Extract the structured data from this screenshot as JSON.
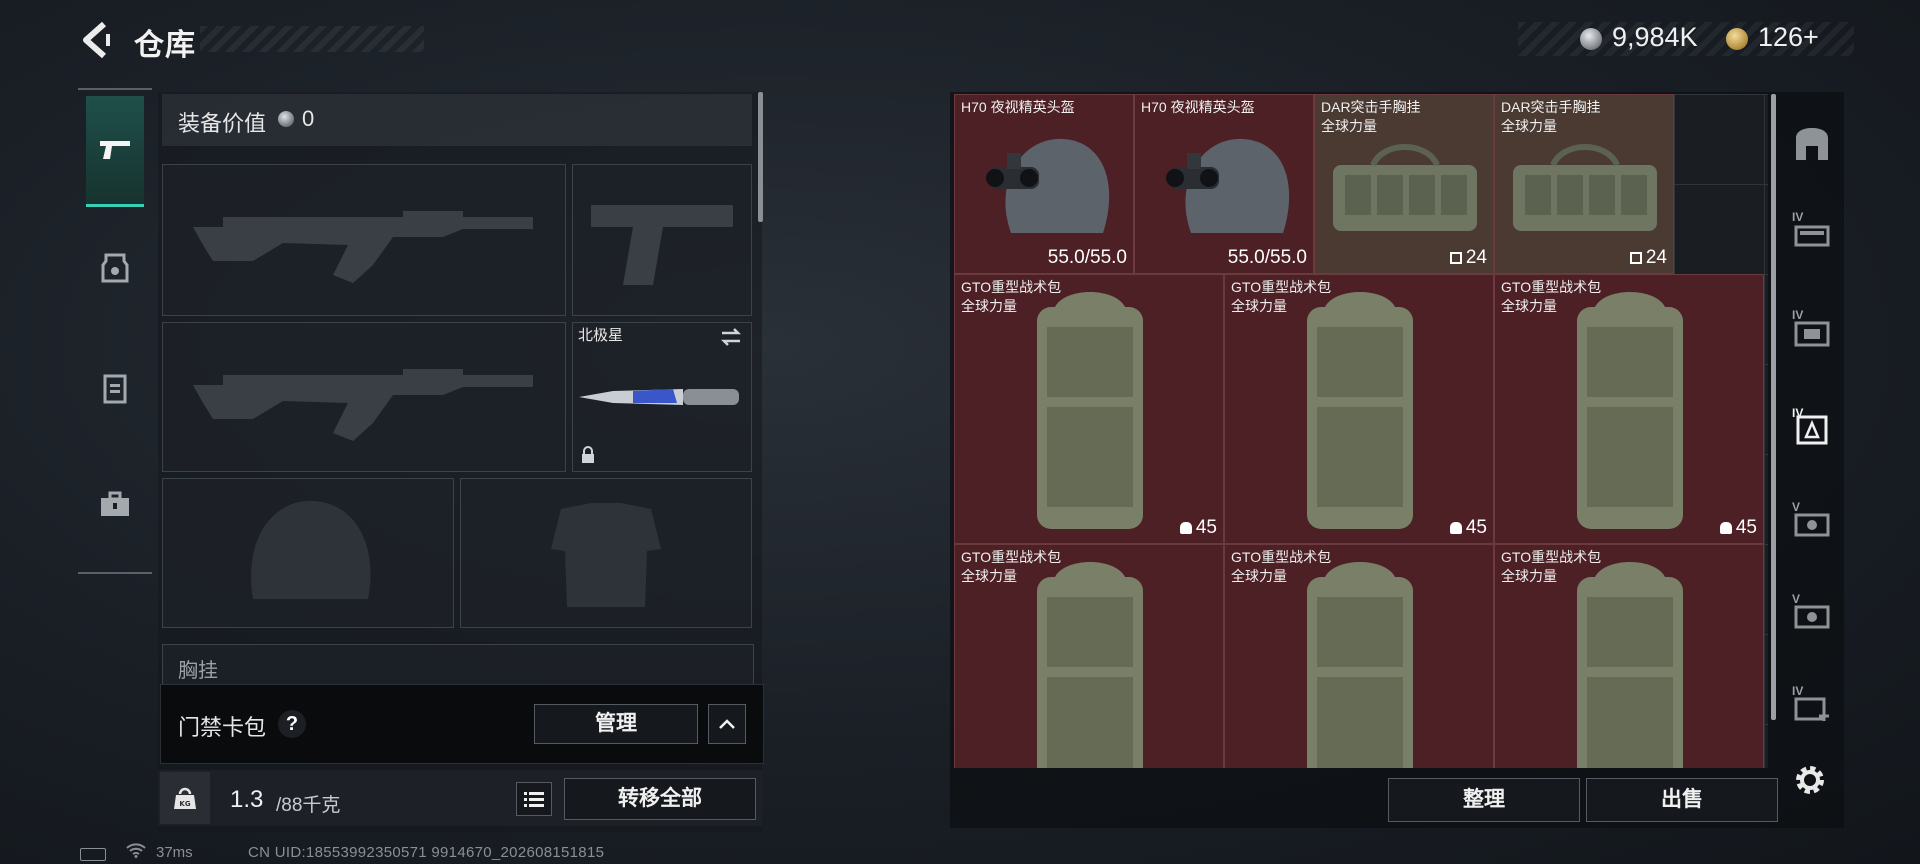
{
  "header": {
    "title": "仓库",
    "currency_silver": "9,984K",
    "currency_gold": "126+"
  },
  "loadout": {
    "equip_value_label": "装备价值",
    "equip_value": "0",
    "knife_name": "北极星",
    "chest_label": "胸挂",
    "keycard_label": "门禁卡包",
    "manage_label": "管理",
    "weight_current": "1.3",
    "weight_max": "/88千克",
    "weight_icon_text": "KG",
    "transfer_all_label": "转移全部"
  },
  "status": {
    "ping": "37ms",
    "uid": "CN UID:18553992350571 9914670_202608151815"
  },
  "stash": {
    "items": [
      {
        "name": "H70 夜视精英头盔",
        "sub": "",
        "stat": "55.0/55.0"
      },
      {
        "name": "H70 夜视精英头盔",
        "sub": "",
        "stat": "55.0/55.0"
      },
      {
        "name": "DAR突击手胸挂",
        "sub": "全球力量",
        "stat": "24"
      },
      {
        "name": "DAR突击手胸挂",
        "sub": "全球力量",
        "stat": "24"
      },
      {
        "name": "GTO重型战术包",
        "sub": "全球力量",
        "stat": "45"
      },
      {
        "name": "GTO重型战术包",
        "sub": "全球力量",
        "stat": "45"
      },
      {
        "name": "GTO重型战术包",
        "sub": "全球力量",
        "stat": "45"
      },
      {
        "name": "GTO重型战术包",
        "sub": "全球力量",
        "stat": ""
      },
      {
        "name": "GTO重型战术包",
        "sub": "全球力量",
        "stat": ""
      },
      {
        "name": "GTO重型战术包",
        "sub": "全球力量",
        "stat": ""
      }
    ],
    "sort_label": "整理",
    "sell_label": "出售"
  },
  "rail": {
    "tags": [
      "IV",
      "IV",
      "IV",
      "V",
      "V",
      "IV"
    ]
  }
}
